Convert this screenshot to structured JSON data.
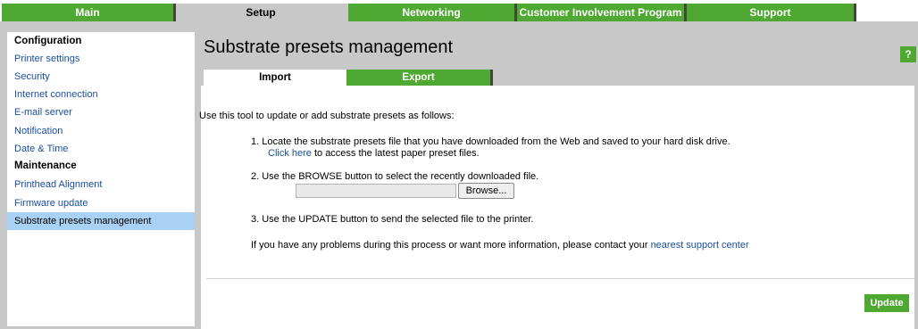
{
  "top_tabs": [
    {
      "label": "Main"
    },
    {
      "label": "Setup"
    },
    {
      "label": "Networking"
    },
    {
      "label": "Customer Involvement Program"
    },
    {
      "label": "Support"
    }
  ],
  "sidebar": {
    "heading_configuration": "Configuration",
    "heading_maintenance": "Maintenance",
    "items": [
      {
        "label": "Printer settings"
      },
      {
        "label": "Security"
      },
      {
        "label": "Internet connection"
      },
      {
        "label": "E-mail server"
      },
      {
        "label": "Notification"
      },
      {
        "label": "Date & Time"
      },
      {
        "label": "Printhead Alignment"
      },
      {
        "label": "Firmware update"
      },
      {
        "label": "Substrate presets management"
      }
    ]
  },
  "main": {
    "title": "Substrate presets management",
    "help_label": "?",
    "tabs": {
      "import": "Import",
      "export": "Export"
    },
    "intro": "Use this tool to update or add substrate presets as follows:",
    "step1": "1. Locate the substrate presets file that you have downloaded from the Web and saved to your hard disk drive.",
    "step1_link": "Click here",
    "step1_rest": " to access the latest paper preset files.",
    "step2": "2. Use the BROWSE button to select the recently downloaded file.",
    "file_value": "",
    "browse_label": "Browse...",
    "step3": "3. Use the UPDATE button to send the selected file to the printer.",
    "help_text": "If you have any problems during this process or want more information, please contact your ",
    "help_link": "nearest support center",
    "update_label": "Update"
  },
  "colors": {
    "accent_green": "#4ea832",
    "link_blue": "#1a4fa0",
    "selected_blue": "#a9d0f5",
    "frame_gray": "#c8c8c8"
  }
}
